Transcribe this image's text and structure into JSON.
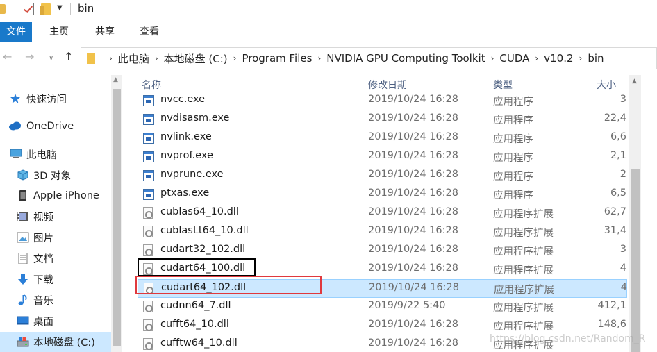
{
  "window": {
    "title": "bin"
  },
  "ribbon": {
    "tabs": [
      {
        "label": "文件",
        "active": true
      },
      {
        "label": "主页"
      },
      {
        "label": "共享"
      },
      {
        "label": "查看"
      }
    ]
  },
  "address": {
    "segments": [
      "此电脑",
      "本地磁盘 (C:)",
      "Program Files",
      "NVIDIA GPU Computing Toolkit",
      "CUDA",
      "v10.2",
      "bin"
    ]
  },
  "nav": {
    "items": [
      {
        "label": "快速访问",
        "icon": "star-icon"
      },
      {
        "label": "OneDrive",
        "icon": "cloud-icon"
      },
      {
        "label": "此电脑",
        "icon": "computer-icon"
      },
      {
        "label": "3D 对象",
        "icon": "cube-icon"
      },
      {
        "label": "Apple iPhone",
        "icon": "phone-icon"
      },
      {
        "label": "视频",
        "icon": "video-icon"
      },
      {
        "label": "图片",
        "icon": "picture-icon"
      },
      {
        "label": "文档",
        "icon": "document-icon"
      },
      {
        "label": "下载",
        "icon": "download-icon"
      },
      {
        "label": "音乐",
        "icon": "music-icon"
      },
      {
        "label": "桌面",
        "icon": "desktop-icon"
      },
      {
        "label": "本地磁盘 (C:)",
        "icon": "drive-icon",
        "selected": true
      }
    ]
  },
  "list": {
    "columns": {
      "name": "名称",
      "date": "修改日期",
      "type": "类型",
      "size": "大小"
    },
    "files": [
      {
        "name": "nvcc.exe",
        "date": "2019/10/24 16:28",
        "type": "应用程序",
        "size": "3",
        "kind": "exe"
      },
      {
        "name": "nvdisasm.exe",
        "date": "2019/10/24 16:28",
        "type": "应用程序",
        "size": "22,4",
        "kind": "exe"
      },
      {
        "name": "nvlink.exe",
        "date": "2019/10/24 16:28",
        "type": "应用程序",
        "size": "6,6",
        "kind": "exe"
      },
      {
        "name": "nvprof.exe",
        "date": "2019/10/24 16:28",
        "type": "应用程序",
        "size": "2,1",
        "kind": "exe"
      },
      {
        "name": "nvprune.exe",
        "date": "2019/10/24 16:28",
        "type": "应用程序",
        "size": "2",
        "kind": "exe"
      },
      {
        "name": "ptxas.exe",
        "date": "2019/10/24 16:28",
        "type": "应用程序",
        "size": "6,5",
        "kind": "exe"
      },
      {
        "name": "cublas64_10.dll",
        "date": "2019/10/24 16:28",
        "type": "应用程序扩展",
        "size": "62,7",
        "kind": "dll"
      },
      {
        "name": "cublasLt64_10.dll",
        "date": "2019/10/24 16:28",
        "type": "应用程序扩展",
        "size": "31,4",
        "kind": "dll"
      },
      {
        "name": "cudart32_102.dll",
        "date": "2019/10/24 16:28",
        "type": "应用程序扩展",
        "size": "3",
        "kind": "dll"
      },
      {
        "name": "cudart64_100.dll",
        "date": "2019/10/24 16:28",
        "type": "应用程序扩展",
        "size": "4",
        "kind": "dll"
      },
      {
        "name": "cudart64_102.dll",
        "date": "2019/10/24 16:28",
        "type": "应用程序扩展",
        "size": "4",
        "kind": "dll",
        "selected": true
      },
      {
        "name": "cudnn64_7.dll",
        "date": "2019/9/22 5:40",
        "type": "应用程序扩展",
        "size": "412,1",
        "kind": "dll"
      },
      {
        "name": "cufft64_10.dll",
        "date": "2019/10/24 16:28",
        "type": "应用程序扩展",
        "size": "148,6",
        "kind": "dll"
      },
      {
        "name": "cufftw64_10.dll",
        "date": "2019/10/24 16:28",
        "type": "应用程序扩展",
        "size": "",
        "kind": "dll"
      }
    ]
  },
  "watermark": "https://blog.csdn.net/Random_R",
  "colors": {
    "accent": "#1979ca",
    "selection": "#cce8ff",
    "highlight_red": "#e0393e"
  }
}
